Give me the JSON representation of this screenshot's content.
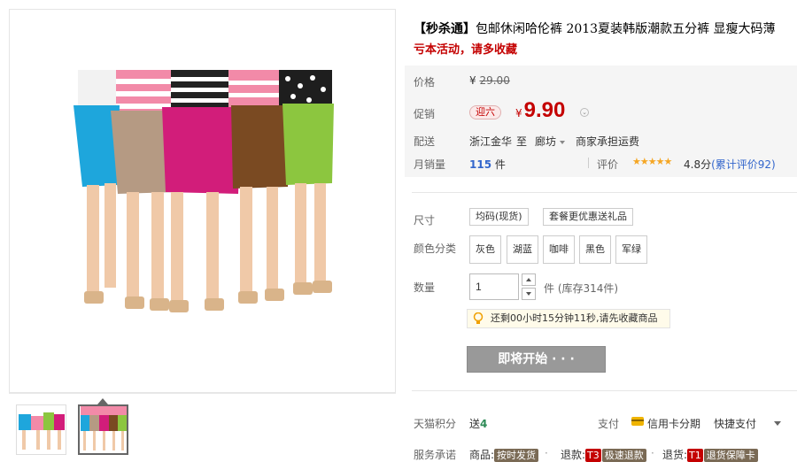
{
  "product": {
    "title_tag": "【秒杀通】",
    "title_text": "包邮休闲哈伦裤 2013夏装韩版潮款五分裤 显瘦大码薄",
    "subtitle": "亏本活动，请多收藏"
  },
  "price": {
    "label": "价格",
    "currency": "¥",
    "original": "29.00"
  },
  "promo": {
    "label": "促销",
    "tag": "迎六",
    "currency": "¥",
    "value": "9.90"
  },
  "shipping": {
    "label": "配送",
    "from": "浙江金华",
    "to_word": "至",
    "to": "廊坊",
    "fee": "商家承担运费"
  },
  "sales": {
    "label": "月销量",
    "count": "115",
    "unit": "件",
    "rating_label": "评价",
    "stars": "★★★★★",
    "score": "4.8分",
    "review_text": "(累计评价92)",
    "rating_value": 4.8
  },
  "size": {
    "label": "尺寸",
    "options": [
      "均码(现货)",
      "套餐更优惠送礼品"
    ]
  },
  "color": {
    "label": "颜色分类",
    "options": [
      "灰色",
      "湖蓝",
      "咖啡",
      "黑色",
      "军绿"
    ]
  },
  "quantity": {
    "label": "数量",
    "value": "1",
    "unit": "件",
    "stock": "(库存314件)"
  },
  "notice": {
    "text": "还剩00小时15分钟11秒,请先收藏商品"
  },
  "buy_button": {
    "label": "即将开始 · · ·"
  },
  "tmall_points": {
    "label": "天猫积分",
    "value_prefix": "送",
    "value": "4"
  },
  "payment": {
    "label": "支付",
    "card": "信用卡分期",
    "quick": "快捷支付"
  },
  "services": {
    "label": "服务承诺",
    "goods_label": "商品:",
    "goods_badge": "按时发货",
    "refund_label": "退款:",
    "refund_code": "T3",
    "refund_badge": "极速退款",
    "return_label": "退货:",
    "return_code": "T1",
    "return_badge": "退货保障卡"
  },
  "colors": {
    "accent_red": "#c40000",
    "link_blue": "#3366cc",
    "star": "#f5a623",
    "button_disabled": "#999999"
  }
}
